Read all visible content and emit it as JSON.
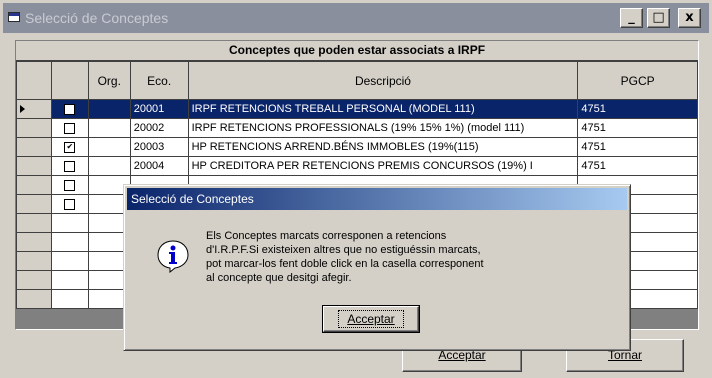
{
  "window": {
    "title": "Selecció de Conceptes",
    "buttons": {
      "minimize": "_",
      "maximize": "□",
      "close": "x"
    }
  },
  "grid": {
    "title": "Conceptes que poden estar associats a IRPF",
    "columns": [
      "",
      "Org.",
      "Eco.",
      "Descripció",
      "PGCP"
    ],
    "rows": [
      {
        "checked": false,
        "org": "",
        "eco": "20001",
        "desc": "IRPF RETENCIONS TREBALL PERSONAL (MODEL 111)",
        "pgcp": "4751"
      },
      {
        "checked": false,
        "org": "",
        "eco": "20002",
        "desc": "IRPF RETENCIONS PROFESSIONALS (19% 15% 1%) (model 111)",
        "pgcp": "4751"
      },
      {
        "checked": true,
        "org": "",
        "eco": "20003",
        "desc": "HP RETENCIONS ARREND.BÉNS IMMOBLES (19%(115)",
        "pgcp": "4751"
      },
      {
        "checked": false,
        "org": "",
        "eco": "20004",
        "desc": "HP CREDITORA PER RETENCIONS PREMIS CONCURSOS (19%) I",
        "pgcp": "4751"
      }
    ]
  },
  "buttons": {
    "accept": "Acceptar",
    "back": "Tornar"
  },
  "dialog": {
    "title": "Selecció de Conceptes",
    "message_lines": [
      "Els Conceptes marcats corresponen a retencions",
      "d'I.R.P.F.Si existeixen altres que no estiguéssin marcats,",
      "pot marcar-los fent doble click en la casella corresponent",
      "al concepte que desitgi afegir."
    ],
    "ok": "Acceptar"
  }
}
